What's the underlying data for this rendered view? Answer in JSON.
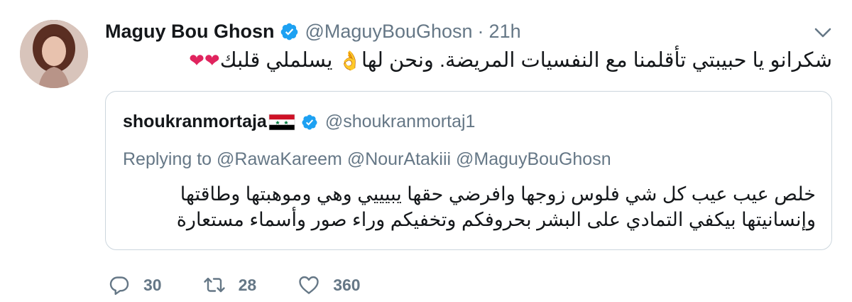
{
  "tweet": {
    "display_name": "Maguy Bou Ghosn",
    "handle": "@MaguyBouGhosn",
    "separator": "·",
    "time": "21h",
    "text_main": "شكرانو يا حبيبتي  تأقلمنا مع النفسيات المريضة. ونحن لها",
    "text_ok_emoji": "👌",
    "text_tail": "يسلملي قلبك",
    "text_hearts": "❤❤"
  },
  "quote": {
    "display_name": "shoukranmortaja",
    "handle": "@shoukranmortaj1",
    "replying_prefix": "Replying to",
    "mentions": [
      "@RawaKareem",
      "@NourAtakiii",
      "@MaguyBouGhosn"
    ],
    "lines": [
      "خلص عيب عيب كل شي فلوس زوجها وافرضي حقها يبيييي  وهي وموهبتها وطاقتها",
      "وإنسانيتها بيكفي التمادي على البشر بحروفكم وتخفيكم وراء صور وأسماء مستعارة"
    ]
  },
  "actions": {
    "replies": "30",
    "retweets": "28",
    "likes": "360"
  },
  "icons": {
    "verified": "verified-badge-icon",
    "caret": "chevron-down-icon",
    "flag": "syria-flag-icon",
    "reply": "reply-icon",
    "retweet": "retweet-icon",
    "like": "heart-icon"
  },
  "colors": {
    "verified_blue": "#1da1f2",
    "secondary_text": "#657786",
    "border": "#ccd6dd"
  }
}
